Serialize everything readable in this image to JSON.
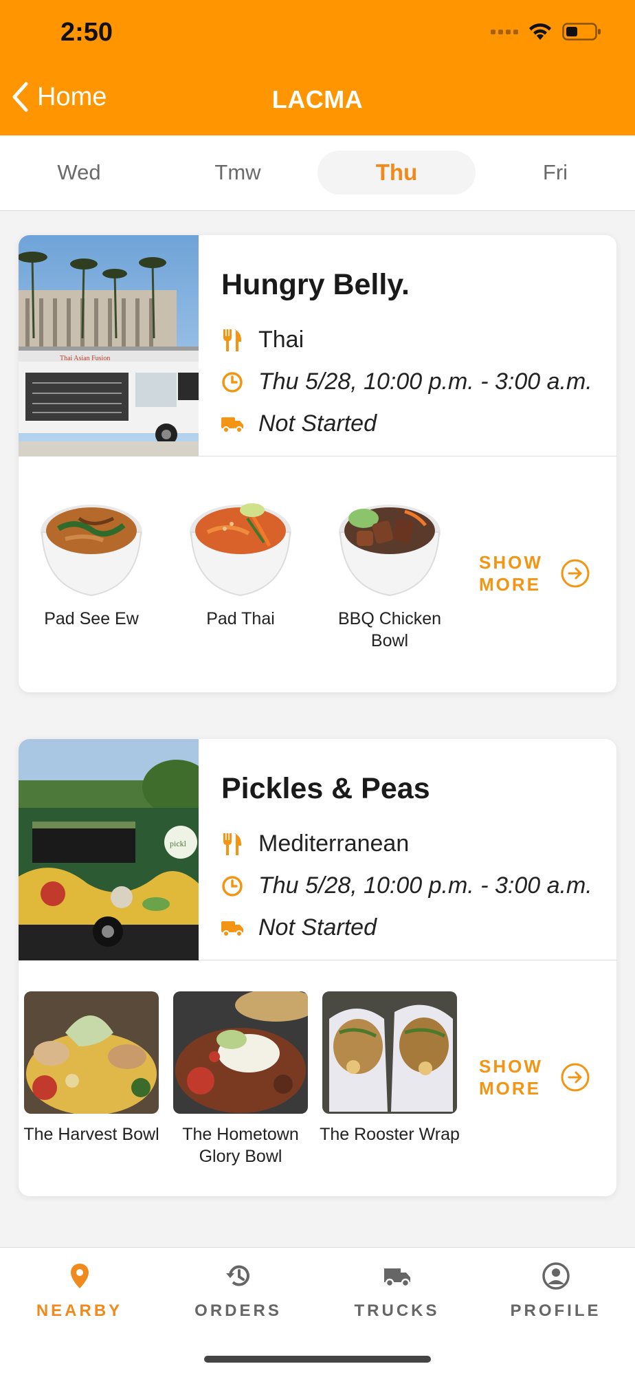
{
  "status_bar": {
    "time": "2:50"
  },
  "nav": {
    "back_label": "Home",
    "title": "LACMA"
  },
  "tabs": [
    {
      "label": "Wed",
      "active": false
    },
    {
      "label": "Tmw",
      "active": false
    },
    {
      "label": "Thu",
      "active": true
    },
    {
      "label": "Fri",
      "active": false
    }
  ],
  "trucks": [
    {
      "name": "Hungry Belly.",
      "cuisine": "Thai",
      "schedule": "Thu 5/28, 10:00 p.m. - 3:00 a.m.",
      "status": "Not Started",
      "items": [
        {
          "name": "Pad See Ew"
        },
        {
          "name": "Pad Thai"
        },
        {
          "name": "BBQ Chicken Bowl"
        }
      ],
      "show_more": "SHOW MORE"
    },
    {
      "name": "Pickles & Peas",
      "cuisine": "Mediterranean",
      "schedule": "Thu 5/28, 10:00 p.m. - 3:00 a.m.",
      "status": "Not Started",
      "items": [
        {
          "name": "The Harvest Bowl"
        },
        {
          "name": "The Hometown Glory Bowl"
        },
        {
          "name": "The Rooster Wrap"
        }
      ],
      "show_more": "SHOW MORE"
    }
  ],
  "bottom_nav": [
    {
      "label": "NEARBY",
      "icon": "location-pin-icon",
      "active": true
    },
    {
      "label": "ORDERS",
      "icon": "history-icon",
      "active": false
    },
    {
      "label": "TRUCKS",
      "icon": "truck-icon",
      "active": false
    },
    {
      "label": "PROFILE",
      "icon": "profile-icon",
      "active": false
    }
  ],
  "colors": {
    "brand": "#ff9500",
    "accent": "#f39512",
    "text": "#1a1a1a"
  }
}
